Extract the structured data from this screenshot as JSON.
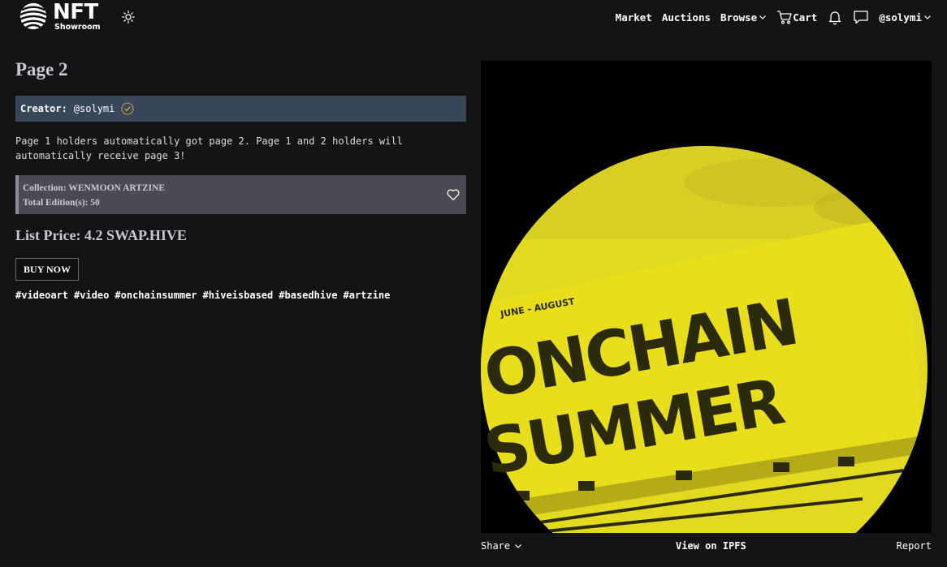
{
  "header": {
    "logo": {
      "title": "NFT",
      "subtitle": "Showroom"
    },
    "nav": {
      "market": "Market",
      "auctions": "Auctions",
      "browse": "Browse",
      "cart": "Cart",
      "user": "@solymi"
    },
    "icons": [
      "globe-logo-icon",
      "sun-icon",
      "chevron-down-icon",
      "cart-icon",
      "bell-icon",
      "chat-icon"
    ]
  },
  "nft": {
    "title": "Page 2",
    "creator_label": "Creator:",
    "creator": "@solymi",
    "description": "Page 1 holders automatically got page 2. Page 1 and 2 holders will automatically receive page 3!",
    "collection": "Collection: WENMOON ARTZINE",
    "editions": "Total Edition(s): 50",
    "list_price": "List Price: 4.2 SWAP.HIVE",
    "buy_label": "BUY NOW",
    "tags": [
      "#videoart",
      "#video",
      "#onchainsummer",
      "#hiveisbased",
      "#basedhive",
      "#artzine"
    ]
  },
  "artwork": {
    "caption": "JUNE - AUGUST",
    "line1": "ONCHAIN",
    "line2": "SUMMER",
    "tint": "#e6dc1e",
    "ink": "#2b2a0d"
  },
  "media_actions": {
    "share": "Share",
    "ipfs": "View on IPFS",
    "report": "Report"
  },
  "colors": {
    "background": "#141416",
    "creator_bar": "#384659",
    "collection_box": "#4a4a53",
    "heading": "#c5cad3"
  }
}
